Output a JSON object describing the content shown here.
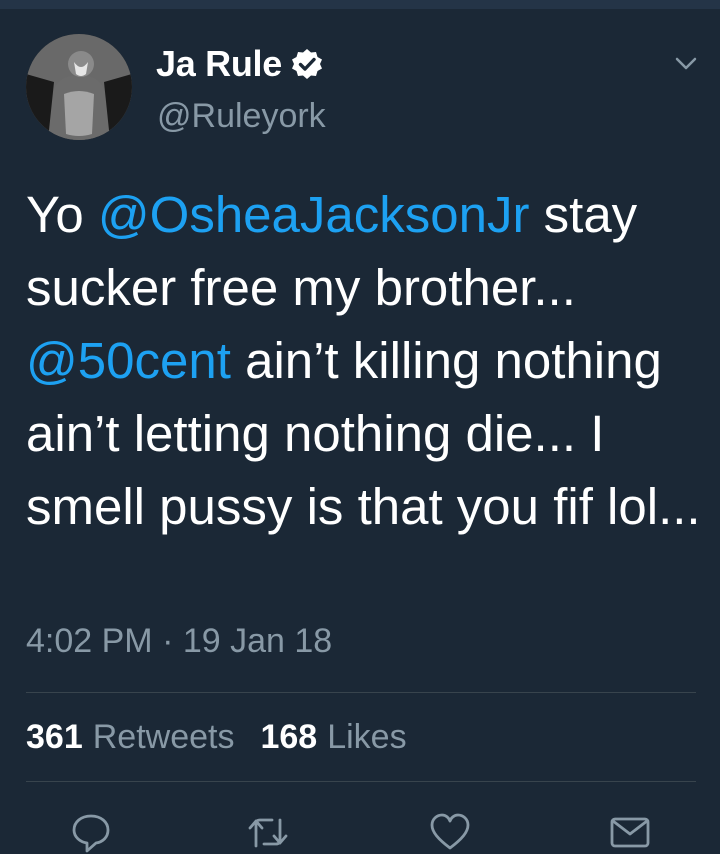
{
  "user": {
    "name": "Ja Rule",
    "handle": "@Ruleyork"
  },
  "tweet": {
    "text_1": "Yo ",
    "mention_1": "@OsheaJacksonJr",
    "text_2": " stay sucker free my brother... ",
    "mention_2": "@50cent",
    "text_3": " ain’t killing nothing ain’t letting nothing die... I smell pussy is that you fif lol...",
    "timestamp": "4:02 PM · 19 Jan 18"
  },
  "stats": {
    "retweets_count": "361",
    "retweets_label": "Retweets",
    "likes_count": "168",
    "likes_label": "Likes"
  },
  "icons": {
    "verified": "verified-badge-icon",
    "menu": "chevron-down-icon",
    "reply": "reply-icon",
    "retweet": "retweet-icon",
    "like": "heart-icon",
    "message": "envelope-icon"
  },
  "colors": {
    "background": "#1b2836",
    "link": "#1da1f2",
    "muted": "#8899a6"
  }
}
